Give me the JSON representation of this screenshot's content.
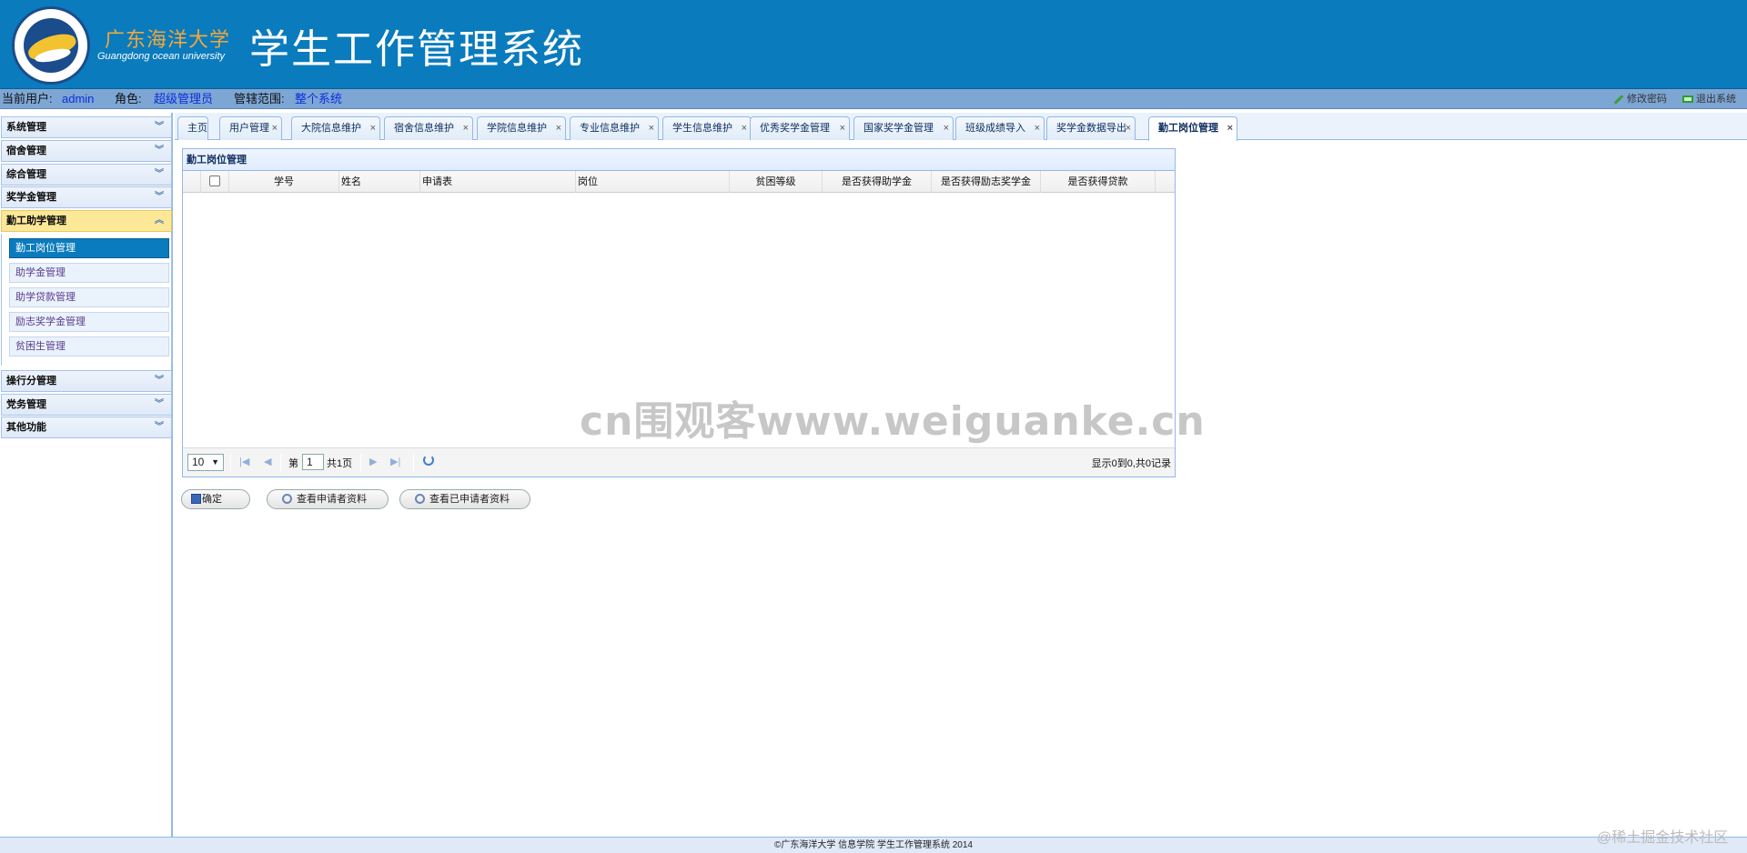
{
  "header": {
    "uni_cn": "广东海洋大学",
    "uni_en": "Guangdong ocean university",
    "title": "学生工作管理系统"
  },
  "userbar": {
    "user_label": "当前用户:",
    "user_value": "admin",
    "role_label": "角色:",
    "role_value": "超级管理员",
    "scope_label": "管辖范围:",
    "scope_value": "整个系统",
    "change_pwd": "修改密码",
    "logout": "退出系统"
  },
  "sidebar": {
    "groups": [
      {
        "label": "系统管理"
      },
      {
        "label": "宿舍管理"
      },
      {
        "label": "综合管理"
      },
      {
        "label": "奖学金管理"
      },
      {
        "label": "勤工助学管理"
      },
      {
        "label": "操行分管理"
      },
      {
        "label": "党务管理"
      },
      {
        "label": "其他功能"
      }
    ],
    "sub_items": [
      {
        "label": "勤工岗位管理"
      },
      {
        "label": "助学金管理"
      },
      {
        "label": "助学贷款管理"
      },
      {
        "label": "励志奖学金管理"
      },
      {
        "label": "贫困生管理"
      }
    ]
  },
  "tabs": [
    {
      "label": "主页"
    },
    {
      "label": "用户管理"
    },
    {
      "label": "大院信息维护"
    },
    {
      "label": "宿舍信息维护"
    },
    {
      "label": "学院信息维护"
    },
    {
      "label": "专业信息维护"
    },
    {
      "label": "学生信息维护"
    },
    {
      "label": "优秀奖学金管理"
    },
    {
      "label": "国家奖学金管理"
    },
    {
      "label": "班级成绩导入"
    },
    {
      "label": "奖学金数据导出"
    },
    {
      "label": "勤工岗位管理"
    }
  ],
  "panel": {
    "title": "勤工岗位管理",
    "columns": [
      "学号",
      "姓名",
      "申请表",
      "岗位",
      "贫困等级",
      "是否获得助学金",
      "是否获得励志奖学金",
      "是否获得贷款"
    ]
  },
  "pager": {
    "page_size": "10",
    "page_prefix": "第",
    "page_value": "1",
    "page_suffix": "共1页",
    "info": "显示0到0,共0记录"
  },
  "buttons": {
    "confirm": "确定",
    "view_applicants": "查看申请者资料",
    "view_applied": "查看已申请者资料"
  },
  "watermark": "cn围观客www.weiguanke.cn",
  "footer": {
    "text": "©广东海洋大学  信息学院  学生工作管理系统 2014",
    "site_mark": "@稀土掘金技术社区"
  }
}
